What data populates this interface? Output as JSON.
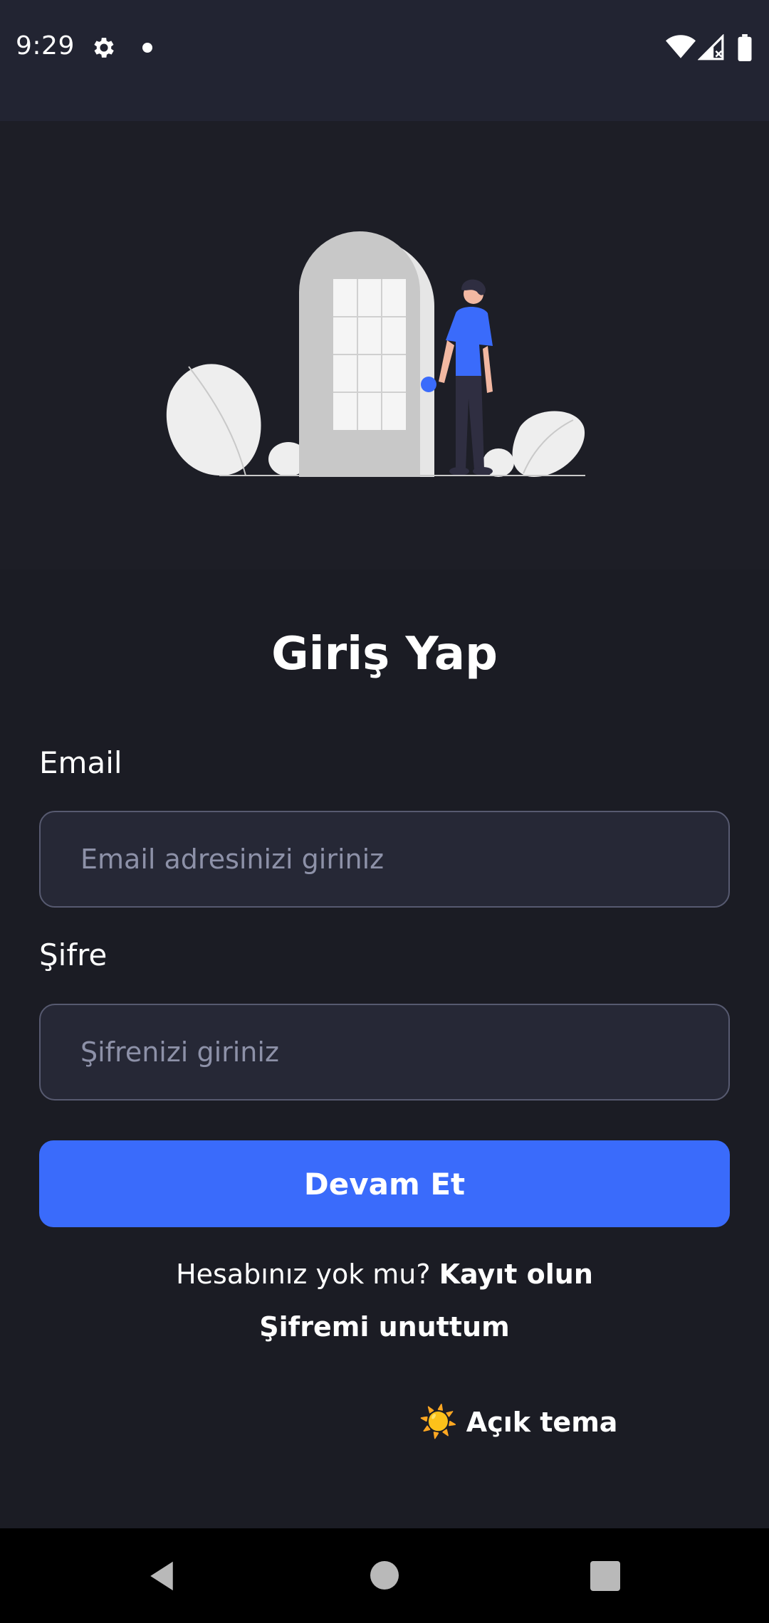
{
  "status_bar": {
    "time": "9:29",
    "icons": [
      "gear-icon",
      "notification-dot-icon",
      "wifi-icon",
      "signal-icon",
      "battery-icon"
    ]
  },
  "hero": {
    "illustration": "person-opening-door-illustration"
  },
  "login": {
    "title": "Giriş Yap",
    "email_label": "Email",
    "email_placeholder": "Email adresinizi giriniz",
    "email_value": "",
    "password_label": "Şifre",
    "password_placeholder": "Şifrenizi giriniz",
    "password_value": "",
    "submit_label": "Devam Et",
    "signup_prompt": "Hesabınız yok mu?",
    "signup_link": "Kayıt olun",
    "forgot_link": "Şifremi unuttum",
    "theme_toggle_icon": "☀️",
    "theme_toggle_label": "Açık tema"
  },
  "nav_bar": {
    "icons": [
      "back-icon",
      "home-icon",
      "recents-icon"
    ]
  },
  "colors": {
    "background": "#1b1c24",
    "status_bar": "#222432",
    "input_background": "#262836",
    "input_border": "#575a70",
    "primary": "#3a6bfb",
    "figure_shirt": "#3a6bfb"
  }
}
